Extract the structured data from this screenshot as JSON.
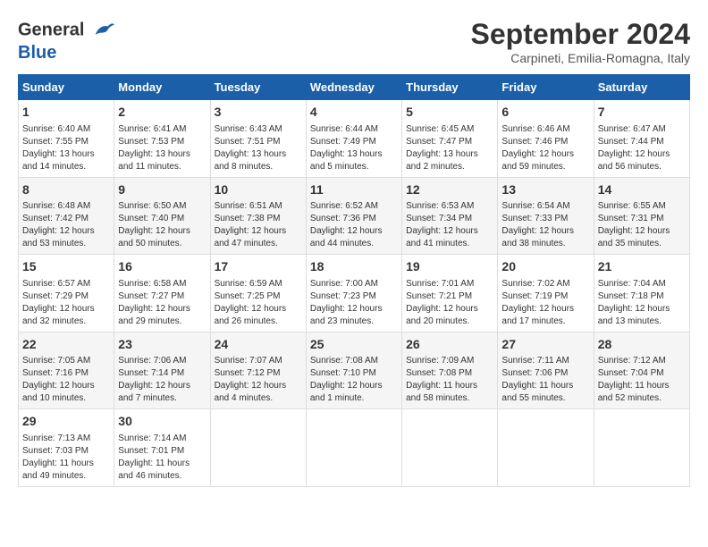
{
  "header": {
    "logo_line1": "General",
    "logo_line2": "Blue",
    "month_year": "September 2024",
    "location": "Carpineti, Emilia-Romagna, Italy"
  },
  "columns": [
    "Sunday",
    "Monday",
    "Tuesday",
    "Wednesday",
    "Thursday",
    "Friday",
    "Saturday"
  ],
  "weeks": [
    [
      {
        "day": "1",
        "sunrise": "Sunrise: 6:40 AM",
        "sunset": "Sunset: 7:55 PM",
        "daylight": "Daylight: 13 hours and 14 minutes."
      },
      {
        "day": "2",
        "sunrise": "Sunrise: 6:41 AM",
        "sunset": "Sunset: 7:53 PM",
        "daylight": "Daylight: 13 hours and 11 minutes."
      },
      {
        "day": "3",
        "sunrise": "Sunrise: 6:43 AM",
        "sunset": "Sunset: 7:51 PM",
        "daylight": "Daylight: 13 hours and 8 minutes."
      },
      {
        "day": "4",
        "sunrise": "Sunrise: 6:44 AM",
        "sunset": "Sunset: 7:49 PM",
        "daylight": "Daylight: 13 hours and 5 minutes."
      },
      {
        "day": "5",
        "sunrise": "Sunrise: 6:45 AM",
        "sunset": "Sunset: 7:47 PM",
        "daylight": "Daylight: 13 hours and 2 minutes."
      },
      {
        "day": "6",
        "sunrise": "Sunrise: 6:46 AM",
        "sunset": "Sunset: 7:46 PM",
        "daylight": "Daylight: 12 hours and 59 minutes."
      },
      {
        "day": "7",
        "sunrise": "Sunrise: 6:47 AM",
        "sunset": "Sunset: 7:44 PM",
        "daylight": "Daylight: 12 hours and 56 minutes."
      }
    ],
    [
      {
        "day": "8",
        "sunrise": "Sunrise: 6:48 AM",
        "sunset": "Sunset: 7:42 PM",
        "daylight": "Daylight: 12 hours and 53 minutes."
      },
      {
        "day": "9",
        "sunrise": "Sunrise: 6:50 AM",
        "sunset": "Sunset: 7:40 PM",
        "daylight": "Daylight: 12 hours and 50 minutes."
      },
      {
        "day": "10",
        "sunrise": "Sunrise: 6:51 AM",
        "sunset": "Sunset: 7:38 PM",
        "daylight": "Daylight: 12 hours and 47 minutes."
      },
      {
        "day": "11",
        "sunrise": "Sunrise: 6:52 AM",
        "sunset": "Sunset: 7:36 PM",
        "daylight": "Daylight: 12 hours and 44 minutes."
      },
      {
        "day": "12",
        "sunrise": "Sunrise: 6:53 AM",
        "sunset": "Sunset: 7:34 PM",
        "daylight": "Daylight: 12 hours and 41 minutes."
      },
      {
        "day": "13",
        "sunrise": "Sunrise: 6:54 AM",
        "sunset": "Sunset: 7:33 PM",
        "daylight": "Daylight: 12 hours and 38 minutes."
      },
      {
        "day": "14",
        "sunrise": "Sunrise: 6:55 AM",
        "sunset": "Sunset: 7:31 PM",
        "daylight": "Daylight: 12 hours and 35 minutes."
      }
    ],
    [
      {
        "day": "15",
        "sunrise": "Sunrise: 6:57 AM",
        "sunset": "Sunset: 7:29 PM",
        "daylight": "Daylight: 12 hours and 32 minutes."
      },
      {
        "day": "16",
        "sunrise": "Sunrise: 6:58 AM",
        "sunset": "Sunset: 7:27 PM",
        "daylight": "Daylight: 12 hours and 29 minutes."
      },
      {
        "day": "17",
        "sunrise": "Sunrise: 6:59 AM",
        "sunset": "Sunset: 7:25 PM",
        "daylight": "Daylight: 12 hours and 26 minutes."
      },
      {
        "day": "18",
        "sunrise": "Sunrise: 7:00 AM",
        "sunset": "Sunset: 7:23 PM",
        "daylight": "Daylight: 12 hours and 23 minutes."
      },
      {
        "day": "19",
        "sunrise": "Sunrise: 7:01 AM",
        "sunset": "Sunset: 7:21 PM",
        "daylight": "Daylight: 12 hours and 20 minutes."
      },
      {
        "day": "20",
        "sunrise": "Sunrise: 7:02 AM",
        "sunset": "Sunset: 7:19 PM",
        "daylight": "Daylight: 12 hours and 17 minutes."
      },
      {
        "day": "21",
        "sunrise": "Sunrise: 7:04 AM",
        "sunset": "Sunset: 7:18 PM",
        "daylight": "Daylight: 12 hours and 13 minutes."
      }
    ],
    [
      {
        "day": "22",
        "sunrise": "Sunrise: 7:05 AM",
        "sunset": "Sunset: 7:16 PM",
        "daylight": "Daylight: 12 hours and 10 minutes."
      },
      {
        "day": "23",
        "sunrise": "Sunrise: 7:06 AM",
        "sunset": "Sunset: 7:14 PM",
        "daylight": "Daylight: 12 hours and 7 minutes."
      },
      {
        "day": "24",
        "sunrise": "Sunrise: 7:07 AM",
        "sunset": "Sunset: 7:12 PM",
        "daylight": "Daylight: 12 hours and 4 minutes."
      },
      {
        "day": "25",
        "sunrise": "Sunrise: 7:08 AM",
        "sunset": "Sunset: 7:10 PM",
        "daylight": "Daylight: 12 hours and 1 minute."
      },
      {
        "day": "26",
        "sunrise": "Sunrise: 7:09 AM",
        "sunset": "Sunset: 7:08 PM",
        "daylight": "Daylight: 11 hours and 58 minutes."
      },
      {
        "day": "27",
        "sunrise": "Sunrise: 7:11 AM",
        "sunset": "Sunset: 7:06 PM",
        "daylight": "Daylight: 11 hours and 55 minutes."
      },
      {
        "day": "28",
        "sunrise": "Sunrise: 7:12 AM",
        "sunset": "Sunset: 7:04 PM",
        "daylight": "Daylight: 11 hours and 52 minutes."
      }
    ],
    [
      {
        "day": "29",
        "sunrise": "Sunrise: 7:13 AM",
        "sunset": "Sunset: 7:03 PM",
        "daylight": "Daylight: 11 hours and 49 minutes."
      },
      {
        "day": "30",
        "sunrise": "Sunrise: 7:14 AM",
        "sunset": "Sunset: 7:01 PM",
        "daylight": "Daylight: 11 hours and 46 minutes."
      },
      null,
      null,
      null,
      null,
      null
    ]
  ]
}
